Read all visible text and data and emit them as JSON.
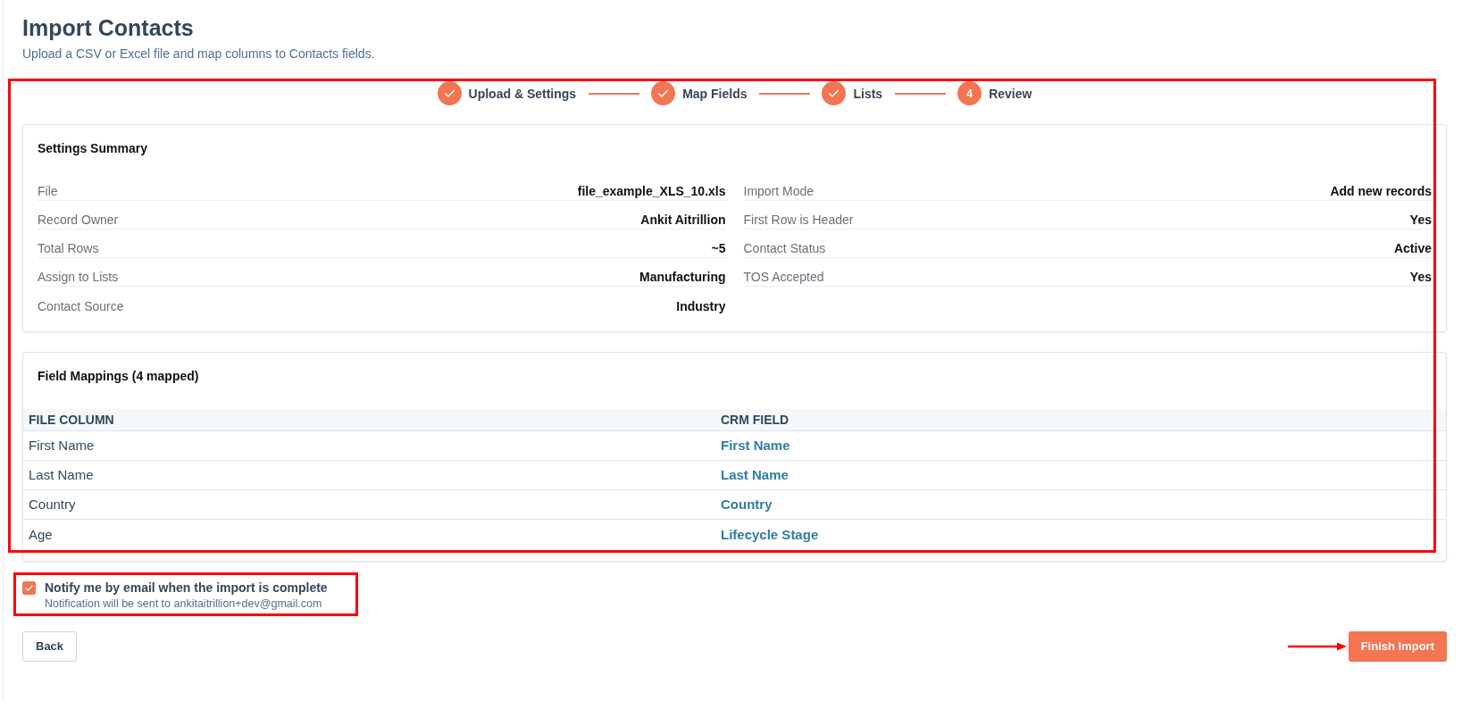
{
  "page": {
    "title": "Import Contacts",
    "subtitle": "Upload a CSV or Excel file and map columns to Contacts fields."
  },
  "stepper": {
    "steps": [
      {
        "label": "Upload & Settings",
        "completed": true
      },
      {
        "label": "Map Fields",
        "completed": true
      },
      {
        "label": "Lists",
        "completed": true
      },
      {
        "label": "Review",
        "number": "4",
        "completed": false
      }
    ]
  },
  "settings_summary": {
    "title": "Settings Summary",
    "items": [
      {
        "label": "File",
        "value": "file_example_XLS_10.xls"
      },
      {
        "label": "Import Mode",
        "value": "Add new records"
      },
      {
        "label": "Record Owner",
        "value": "Ankit Aitrillion"
      },
      {
        "label": "First Row is Header",
        "value": "Yes"
      },
      {
        "label": "Total Rows",
        "value": "~5"
      },
      {
        "label": "Contact Status",
        "value": "Active"
      },
      {
        "label": "Assign to Lists",
        "value": "Manufacturing"
      },
      {
        "label": "TOS Accepted",
        "value": "Yes"
      },
      {
        "label": "Contact Source",
        "value": "Industry"
      }
    ]
  },
  "field_mappings": {
    "title": "Field Mappings (4 mapped)",
    "columns": [
      "FILE COLUMN",
      "CRM FIELD"
    ],
    "rows": [
      {
        "file_column": "First Name",
        "crm_field": "First Name"
      },
      {
        "file_column": "Last Name",
        "crm_field": "Last Name"
      },
      {
        "file_column": "Country",
        "crm_field": "Country"
      },
      {
        "file_column": "Age",
        "crm_field": "Lifecycle Stage"
      }
    ]
  },
  "notify": {
    "checked": true,
    "label": "Notify me by email when the import is complete",
    "note": "Notification will be sent to ankitaitrillion+dev@gmail.com"
  },
  "buttons": {
    "back": "Back",
    "finish": "Finish Import"
  },
  "annotations": {
    "frame_around_review": true,
    "frame_around_notify": true,
    "arrow_to_finish": true
  }
}
